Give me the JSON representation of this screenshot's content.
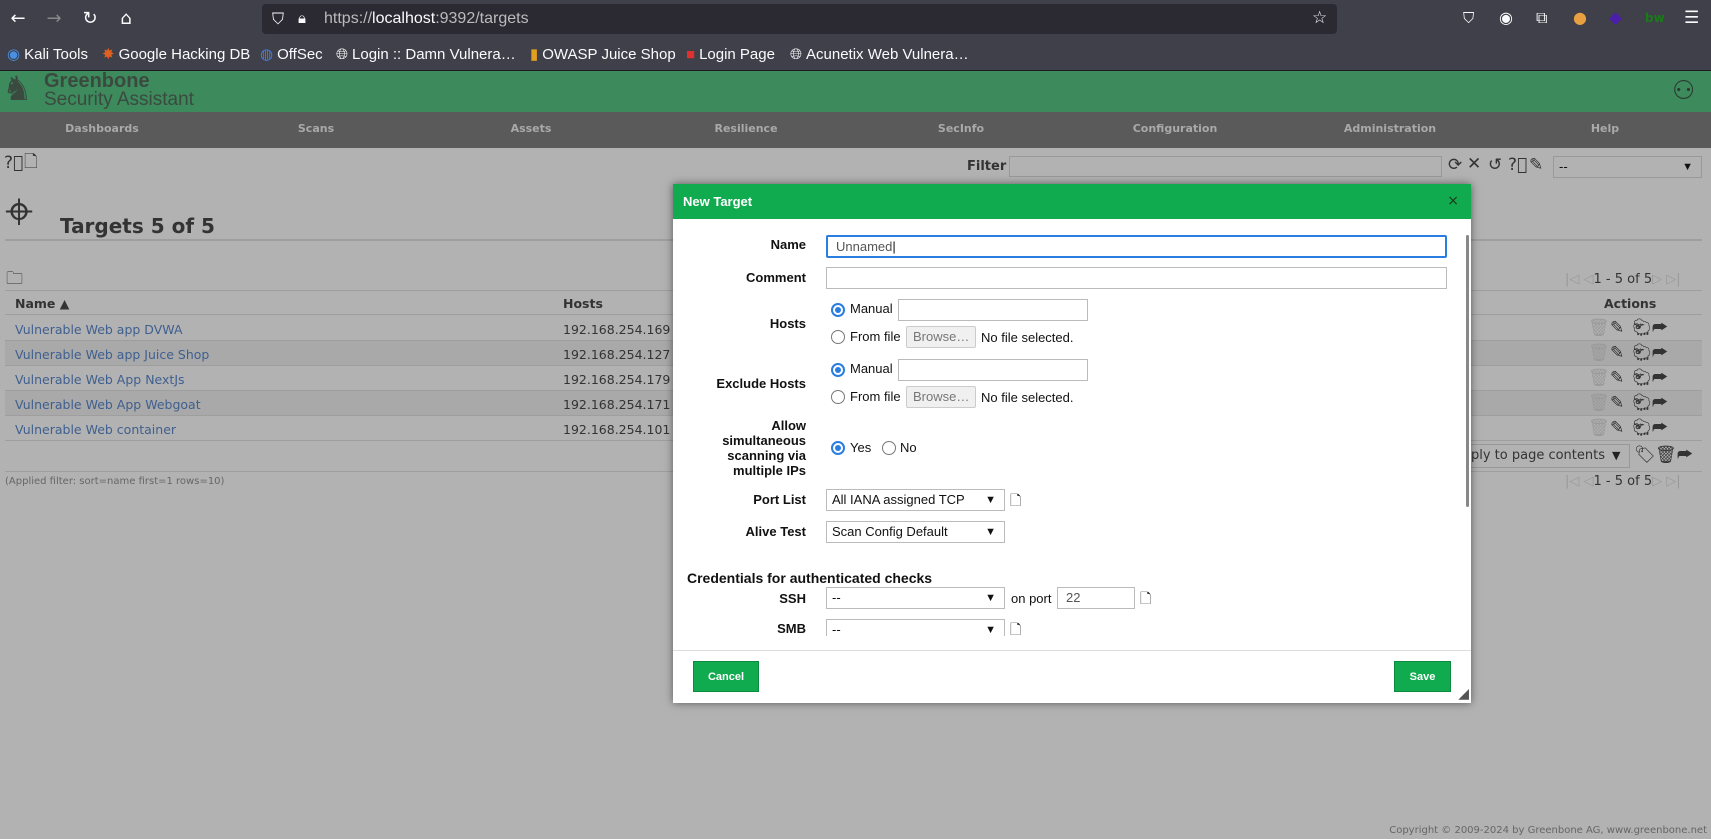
{
  "browser": {
    "url_prefix": "https://",
    "url_host": "localhost",
    "url_rest": ":9392/targets",
    "bookmarks": [
      "Kali Tools",
      "Google Hacking DB",
      "OffSec",
      "Login :: Damn Vulnera…",
      "OWASP Juice Shop",
      "Login Page",
      "Acunetix Web Vulnera…"
    ]
  },
  "app": {
    "logo_line1": "Greenbone",
    "logo_line2": "Security Assistant",
    "nav": [
      "Dashboards",
      "Scans",
      "Assets",
      "Resilience",
      "SecInfo",
      "Configuration",
      "Administration",
      "Help"
    ]
  },
  "toolbar": {
    "filter_label": "Filter",
    "filter_value": "",
    "filter_select": "--"
  },
  "page": {
    "title": "Targets 5 of 5",
    "pagination": "1 - 5 of 5",
    "applied_filter": "(Applied filter: sort=name first=1 rows=10)",
    "bulk_select": "Apply to page contents",
    "copyright": "Copyright © 2009-2024 by Greenbone AG, www.greenbone.net"
  },
  "table": {
    "columns": [
      "Name ▲",
      "Hosts",
      "Actions"
    ],
    "rows": [
      {
        "name": "Vulnerable Web app DVWA",
        "hosts": "192.168.254.169"
      },
      {
        "name": "Vulnerable Web app Juice Shop",
        "hosts": "192.168.254.127"
      },
      {
        "name": "Vulnerable Web App NextJs",
        "hosts": "192.168.254.179"
      },
      {
        "name": "Vulnerable Web App Webgoat",
        "hosts": "192.168.254.171"
      },
      {
        "name": "Vulnerable Web container",
        "hosts": "192.168.254.101"
      }
    ]
  },
  "dialog": {
    "title": "New Target",
    "close": "×",
    "name_label": "Name",
    "name_value": "Unnamed",
    "comment_label": "Comment",
    "comment_value": "",
    "hosts_label": "Hosts",
    "manual": "Manual",
    "from_file": "From file",
    "browse": "Browse…",
    "no_file": "No file selected.",
    "exclude_label": "Exclude Hosts",
    "allow_label": "Allow simultaneous scanning via multiple IPs",
    "yes": "Yes",
    "no": "No",
    "port_list_label": "Port List",
    "port_list_value": "All IANA assigned TCP",
    "alive_label": "Alive Test",
    "alive_value": "Scan Config Default",
    "cred_heading": "Credentials for authenticated checks",
    "ssh_label": "SSH",
    "ssh_value": "--",
    "on_port": "on port",
    "port_value": "22",
    "smb_label": "SMB",
    "smb_value": "--",
    "cancel": "Cancel",
    "save": "Save"
  },
  "colors": {
    "dialog_header": "#11ab4f",
    "header_green": "#3d8a5d",
    "radio_accent": "#2a7de1"
  }
}
